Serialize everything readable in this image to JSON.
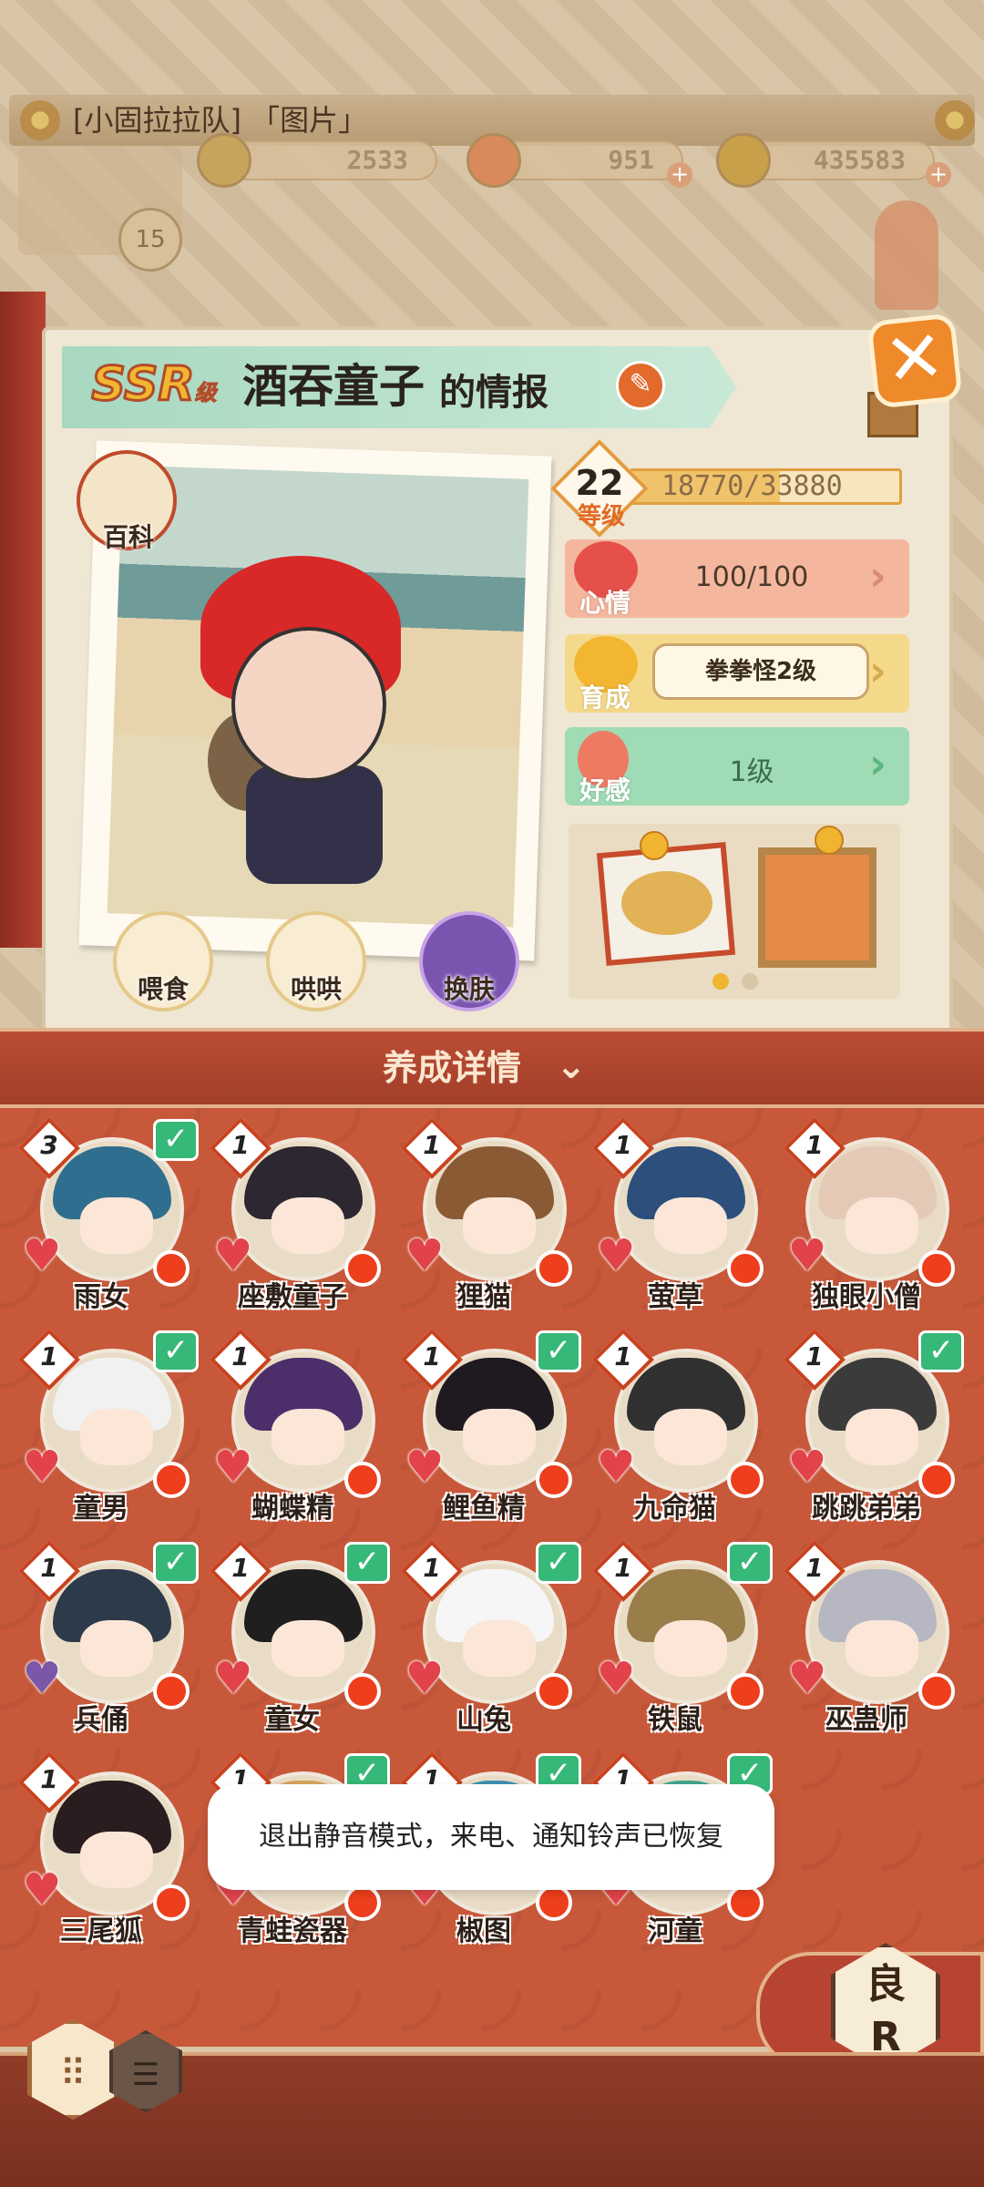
{
  "header": {
    "title": "[小固拉拉队] 「图片」",
    "player_level": "15",
    "resources": [
      "2533",
      "951",
      "435583"
    ]
  },
  "card": {
    "rarity": "SSR",
    "rarity_suffix": "级",
    "name": "酒吞童子",
    "name_suffix": "的情报",
    "encyclopedia_label": "百科",
    "actions": [
      "喂食",
      "哄哄",
      "换肤"
    ],
    "level": "22",
    "level_label": "等级",
    "exp_text": "18770/33880",
    "exp_progress": 0.554,
    "stats": [
      {
        "label": "心情",
        "value": "100/100",
        "color": "#f2a98c"
      },
      {
        "label": "育成",
        "value": "拳拳怪2级",
        "color": "#f3d67a"
      },
      {
        "label": "好感",
        "value": "1级",
        "color": "#8fd6a8"
      }
    ],
    "pager": {
      "pages": 2,
      "active": 0
    }
  },
  "section": {
    "title": "养成详情"
  },
  "shikigami": [
    {
      "name": "雨女",
      "level": "3",
      "checked": true,
      "hair": "#2f6e8f",
      "heart": "red"
    },
    {
      "name": "座敷童子",
      "level": "1",
      "checked": false,
      "hair": "#2c2730",
      "heart": "red"
    },
    {
      "name": "狸猫",
      "level": "1",
      "checked": false,
      "hair": "#8a5a34",
      "heart": "red"
    },
    {
      "name": "萤草",
      "level": "1",
      "checked": false,
      "hair": "#2d4f7c",
      "heart": "red"
    },
    {
      "name": "独眼小僧",
      "level": "1",
      "checked": false,
      "hair": "#e4c9b6",
      "heart": "red"
    },
    {
      "name": "童男",
      "level": "1",
      "checked": true,
      "hair": "#f1f1f1",
      "heart": "red"
    },
    {
      "name": "蝴蝶精",
      "level": "1",
      "checked": false,
      "hair": "#4b2e6a",
      "heart": "red"
    },
    {
      "name": "鲤鱼精",
      "level": "1",
      "checked": true,
      "hair": "#1f1a20",
      "heart": "red"
    },
    {
      "name": "九命猫",
      "level": "1",
      "checked": false,
      "hair": "#303030",
      "heart": "red"
    },
    {
      "name": "跳跳弟弟",
      "level": "1",
      "checked": true,
      "hair": "#3b3b3b",
      "heart": "red"
    },
    {
      "name": "兵俑",
      "level": "1",
      "checked": true,
      "hair": "#2c3a4a",
      "heart": "purple"
    },
    {
      "name": "童女",
      "level": "1",
      "checked": true,
      "hair": "#1f1f1f",
      "heart": "red"
    },
    {
      "name": "山兔",
      "level": "1",
      "checked": true,
      "hair": "#f6f6f6",
      "heart": "red"
    },
    {
      "name": "铁鼠",
      "level": "1",
      "checked": true,
      "hair": "#9a7e4a",
      "heart": "red"
    },
    {
      "name": "巫蛊师",
      "level": "1",
      "checked": false,
      "hair": "#b7b7c4",
      "heart": "red"
    },
    {
      "name": "三尾狐",
      "level": "1",
      "checked": false,
      "hair": "#2a1d1f",
      "heart": "red"
    },
    {
      "name": "青蛙瓷器",
      "level": "1",
      "checked": true,
      "hair": "#d7a35c",
      "heart": "red"
    },
    {
      "name": "椒图",
      "level": "1",
      "checked": true,
      "hair": "#3e8fb0",
      "heart": "red"
    },
    {
      "name": "河童",
      "level": "1",
      "checked": true,
      "hair": "#3fa58e",
      "heart": "red"
    }
  ],
  "toast": "退出静音模式，来电、通知铃声已恢复",
  "rank_badge": "良\nR"
}
